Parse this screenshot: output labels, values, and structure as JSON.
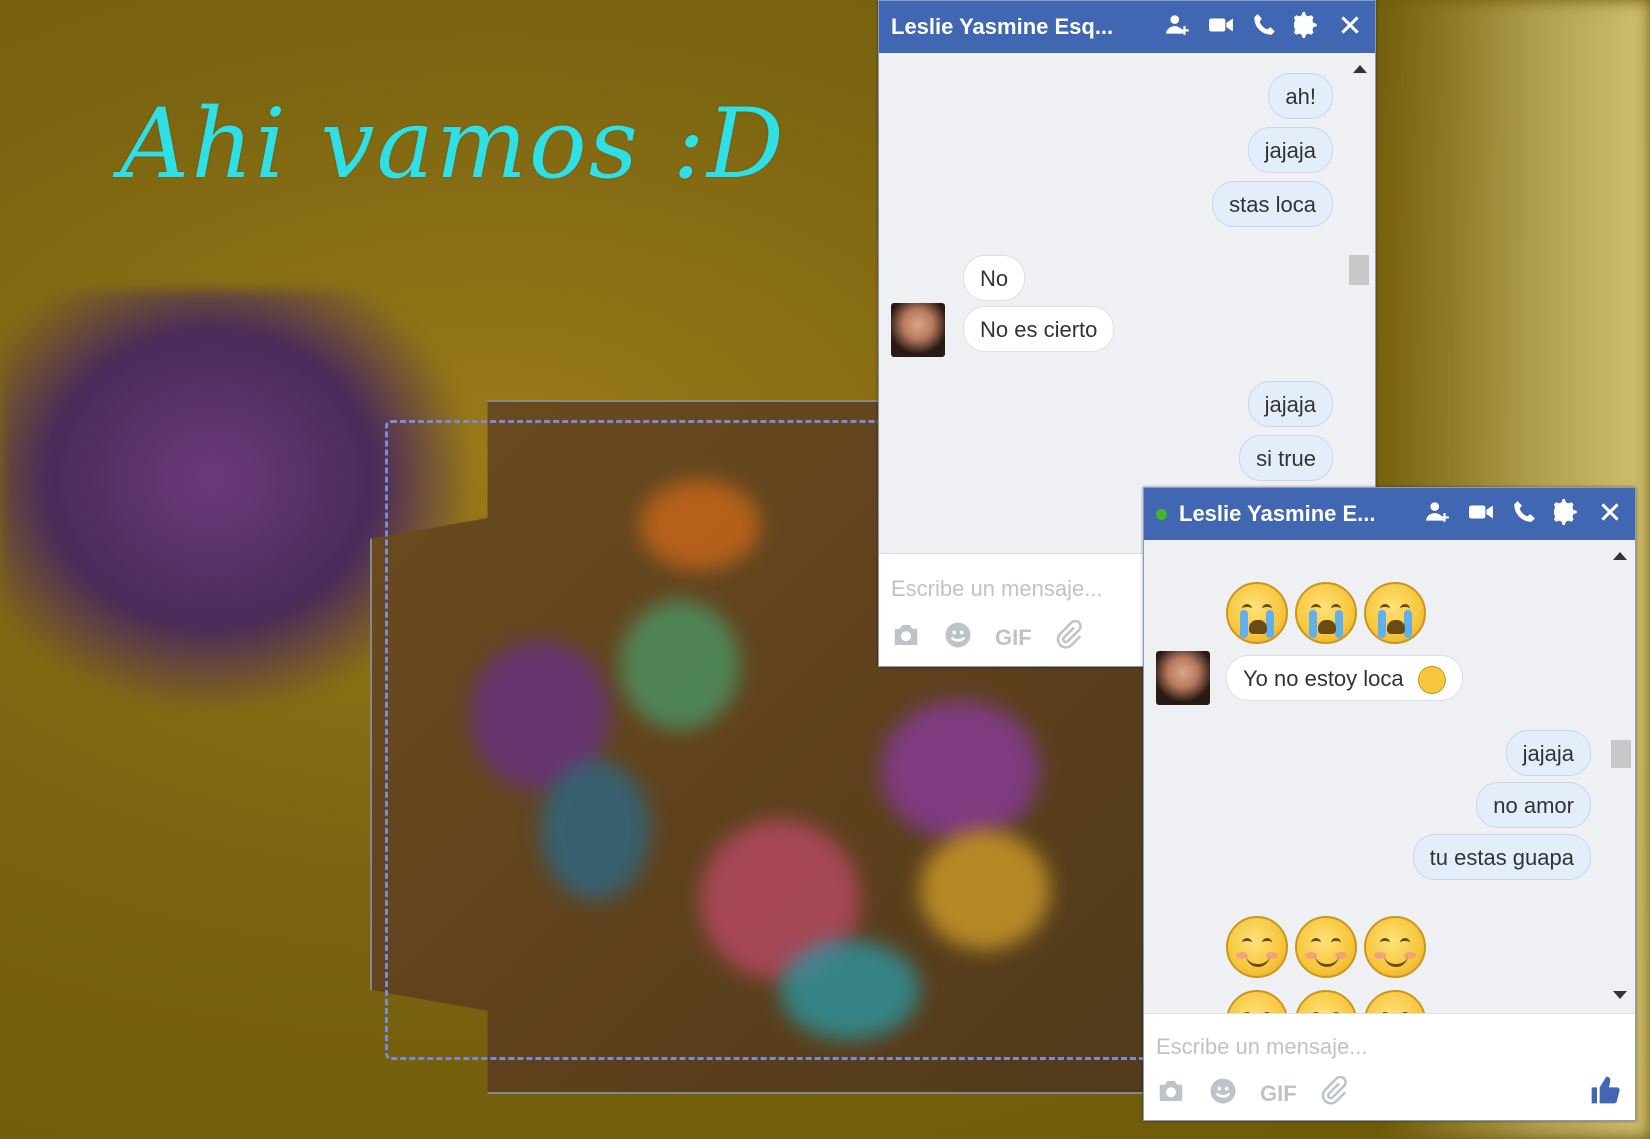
{
  "headline": "Ahi vamos :D",
  "colors": {
    "headline": "#2ee0e6",
    "header": "#4267b2",
    "online": "#42b72a"
  },
  "chat_back": {
    "title": "Leslie Yasmine Esq...",
    "header_icons": [
      "add-person-icon",
      "video-call-icon",
      "phone-icon",
      "gear-icon",
      "close-icon"
    ],
    "messages": [
      {
        "from": "me",
        "text": "ah!"
      },
      {
        "from": "me",
        "text": "jajaja"
      },
      {
        "from": "me",
        "text": "stas loca"
      },
      {
        "from": "them",
        "text": "No"
      },
      {
        "from": "them",
        "text": "No es cierto"
      },
      {
        "from": "me",
        "text": "jajaja"
      },
      {
        "from": "me",
        "text": "si true"
      }
    ],
    "placeholder": "Escribe un mensaje...",
    "tools": [
      "camera-icon",
      "emoji-icon",
      "GIF",
      "attachment-icon"
    ]
  },
  "chat_front": {
    "title": "Leslie Yasmine E...",
    "online": true,
    "header_icons": [
      "add-person-icon",
      "video-call-icon",
      "phone-icon",
      "gear-icon",
      "close-icon"
    ],
    "messages": [
      {
        "from": "them",
        "emoji": [
          "crying",
          "crying",
          "crying"
        ]
      },
      {
        "from": "them",
        "text": "Yo no estoy loca"
      },
      {
        "from": "me",
        "text": "jajaja"
      },
      {
        "from": "me",
        "text": "no amor"
      },
      {
        "from": "me",
        "text": "tu estas guapa"
      },
      {
        "from": "me",
        "emoji": [
          "smiling-blush",
          "smiling-blush",
          "smiling-blush"
        ]
      }
    ],
    "placeholder": "Escribe un mensaje...",
    "tools": [
      "camera-icon",
      "emoji-icon",
      "GIF",
      "attachment-icon"
    ],
    "like_icon": "thumbs-up-icon"
  }
}
